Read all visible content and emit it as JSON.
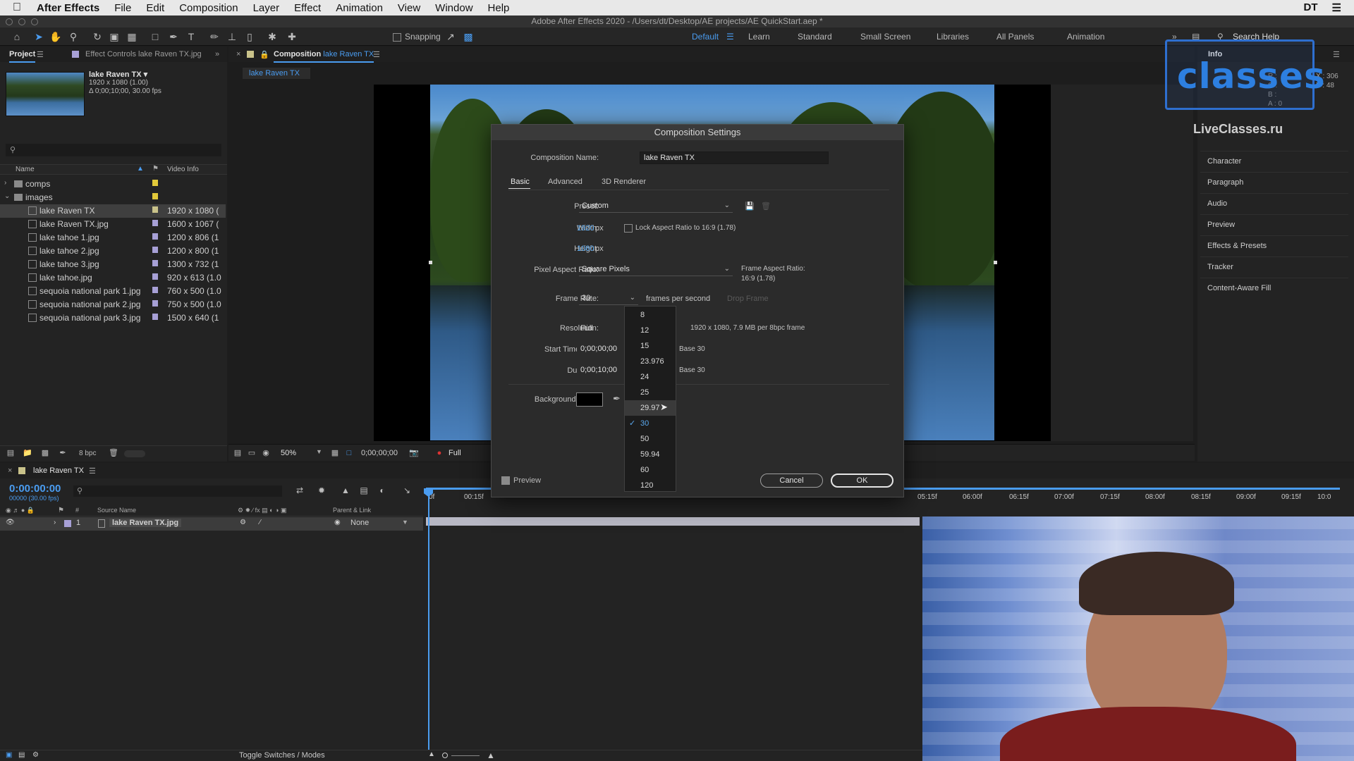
{
  "menubar": {
    "app": "After Effects",
    "items": [
      "File",
      "Edit",
      "Composition",
      "Layer",
      "Effect",
      "Animation",
      "View",
      "Window",
      "Help"
    ],
    "user": "DT"
  },
  "window": {
    "title": "Adobe After Effects 2020 - /Users/dt/Desktop/AE projects/AE QuickStart.aep *"
  },
  "toolbar": {
    "snapping_label": "Snapping",
    "workspaces": [
      "Default",
      "Learn",
      "Standard",
      "Small Screen",
      "Libraries",
      "All Panels",
      "Animation"
    ],
    "active_workspace": "Default",
    "search_help": "Search Help"
  },
  "project_panel": {
    "tab_project": "Project",
    "tab_effect_controls": "Effect Controls lake Raven TX.jpg",
    "selected_name": "lake Raven TX ▾",
    "selected_size": "1920 x 1080 (1.00)",
    "selected_duration": "Δ 0;00;10;00, 30.00 fps",
    "search_placeholder": "",
    "col_name": "Name",
    "col_video_info": "Video Info",
    "items": [
      {
        "name": "comps",
        "type": "folder",
        "info": "",
        "indent": 0,
        "label_color": "#e2c93a"
      },
      {
        "name": "images",
        "type": "folder",
        "info": "",
        "indent": 0,
        "label_color": "#e2c93a"
      },
      {
        "name": "lake Raven TX",
        "type": "comp",
        "info": "1920 x 1080 (",
        "indent": 1,
        "label_color": "#c9c28a",
        "selected": true
      },
      {
        "name": "lake Raven TX.jpg",
        "type": "image",
        "info": "1600 x 1067 (",
        "indent": 1,
        "label_color": "#a7a0d6"
      },
      {
        "name": "lake tahoe 1.jpg",
        "type": "image",
        "info": "1200 x 806 (1",
        "indent": 1,
        "label_color": "#a7a0d6"
      },
      {
        "name": "lake tahoe 2.jpg",
        "type": "image",
        "info": "1200 x 800 (1",
        "indent": 1,
        "label_color": "#a7a0d6"
      },
      {
        "name": "lake tahoe 3.jpg",
        "type": "image",
        "info": "1300 x 732 (1",
        "indent": 1,
        "label_color": "#a7a0d6"
      },
      {
        "name": "lake tahoe.jpg",
        "type": "image",
        "info": "920 x 613 (1.0",
        "indent": 1,
        "label_color": "#a7a0d6"
      },
      {
        "name": "sequoia national park 1.jpg",
        "type": "image",
        "info": "760 x 500 (1.0",
        "indent": 1,
        "label_color": "#a7a0d6"
      },
      {
        "name": "sequoia national park 2.jpg",
        "type": "image",
        "info": "750 x 500 (1.0",
        "indent": 1,
        "label_color": "#a7a0d6"
      },
      {
        "name": "sequoia national park 3.jpg",
        "type": "image",
        "info": "1500 x 640 (1",
        "indent": 1,
        "label_color": "#a7a0d6"
      }
    ],
    "footer_bpc": "8 bpc"
  },
  "composition_panel": {
    "tab": "Composition",
    "tab_comp_name": "lake Raven TX",
    "subtab": "lake Raven TX",
    "zoom": "50%",
    "timecode": "0;00;00;00",
    "resolution": "Full"
  },
  "dialog": {
    "title": "Composition Settings",
    "comp_name_label": "Composition Name:",
    "comp_name": "lake Raven TX",
    "tabs": [
      "Basic",
      "Advanced",
      "3D Renderer"
    ],
    "preset_label": "Preset:",
    "preset": "Custom",
    "width_label": "Width:",
    "width": "1920",
    "height_label": "Height:",
    "height": "1080",
    "px": "px",
    "lock_aspect": "Lock Aspect Ratio to 16:9 (1.78)",
    "par_label": "Pixel Aspect Ratio:",
    "par": "Square Pixels",
    "frame_aspect_label": "Frame Aspect Ratio:",
    "frame_aspect": "16:9 (1.78)",
    "frame_rate_label": "Frame Rate:",
    "frame_rate": "30",
    "fps_unit": "frames per second",
    "drop_frame": "Drop Frame",
    "resolution_label": "Resolution:",
    "resolution": "Full",
    "resolution_info": "1920 x 1080, 7.9 MB per 8bpc frame",
    "start_tc_label": "Start Timecode:",
    "start_tc": "0;00;00;00",
    "duration_label": "Duration:",
    "duration": "0;00;10;00",
    "base": "Base 30",
    "bg_label": "Background Color:",
    "bg_color": "#000000",
    "preview": "Preview",
    "cancel": "Cancel",
    "ok": "OK"
  },
  "fps_menu": {
    "options": [
      "8",
      "12",
      "15",
      "23.976",
      "24",
      "25",
      "29.97",
      "30",
      "50",
      "59.94",
      "60",
      "120"
    ],
    "selected": "30",
    "hovered": "29.97"
  },
  "right_panel": {
    "info_tab": "Info",
    "info_lines": [
      "R :",
      "G :",
      "B :",
      "A : 0"
    ],
    "coords": [
      "X : 306",
      "Y : 48"
    ],
    "watermark_logo": "classes",
    "watermark_site": "LiveClasses.ru",
    "panels": [
      "Character",
      "Paragraph",
      "Audio",
      "Preview",
      "Effects & Presets",
      "Tracker",
      "Content-Aware Fill"
    ]
  },
  "timeline": {
    "tab": "lake Raven TX",
    "timecode": "0:00:00:00",
    "frames": "00000 (30.00 fps)",
    "col_num": "#",
    "col_source": "Source Name",
    "col_parent": "Parent & Link",
    "layer_index": "1",
    "layer_name": "lake Raven TX.jpg",
    "layer_parent": "None",
    "ruler": [
      "0f",
      "00:15f",
      "05:15f",
      "06:00f",
      "06:15f",
      "07:00f",
      "07:15f",
      "08:00f",
      "08:15f",
      "09:00f",
      "09:15f",
      "10:0"
    ],
    "toggle_label": "Toggle Switches / Modes"
  },
  "colors": {
    "accent": "#4a9cf0",
    "panel": "#232323",
    "dialog": "#2b2b2b"
  }
}
